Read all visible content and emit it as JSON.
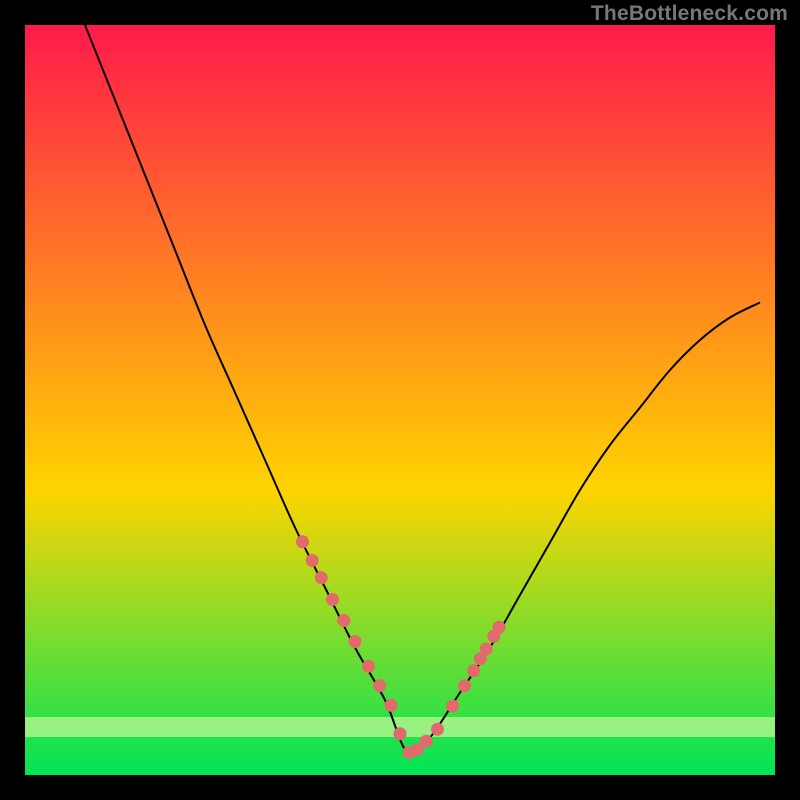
{
  "watermark": "TheBottleneck.com",
  "chart_data": {
    "type": "line",
    "title": "",
    "xlabel": "",
    "ylabel": "",
    "xlim": [
      0,
      100
    ],
    "ylim": [
      0,
      100
    ],
    "grid": false,
    "legend": false,
    "background_gradient": [
      "#ff1a4b",
      "#ffd400",
      "#00e457"
    ],
    "curve_note": "Single V-shaped black curve; minimum near x≈51, y≈3. Red dot markers along low portion of curve between x≈37 and x≈63.",
    "series": [
      {
        "name": "curve",
        "color": "#000000",
        "x": [
          8,
          12,
          16,
          20,
          24,
          28,
          32,
          36,
          40,
          44,
          48,
          51,
          54,
          58,
          62,
          66,
          70,
          74,
          78,
          82,
          86,
          90,
          94,
          98
        ],
        "y": [
          100,
          90,
          80,
          70,
          60,
          51,
          42,
          33,
          25,
          17,
          10,
          3,
          5,
          11,
          17,
          24,
          31,
          38,
          44,
          49,
          54,
          58,
          61,
          63
        ]
      },
      {
        "name": "markers",
        "color": "#e36a6a",
        "type": "scatter",
        "x": [
          37.0,
          38.3,
          39.5,
          41.0,
          42.5,
          44.0,
          45.8,
          47.3,
          48.8,
          50.0,
          51.2,
          52.3,
          53.5,
          55.0,
          57.0,
          58.6,
          59.8,
          60.7,
          61.5,
          62.5,
          63.2
        ],
        "y": [
          31.1,
          28.6,
          26.3,
          23.4,
          20.6,
          17.8,
          14.5,
          11.9,
          9.3,
          5.5,
          3.0,
          3.4,
          4.5,
          6.1,
          9.2,
          11.9,
          13.9,
          15.5,
          16.8,
          18.5,
          19.7
        ]
      }
    ]
  }
}
